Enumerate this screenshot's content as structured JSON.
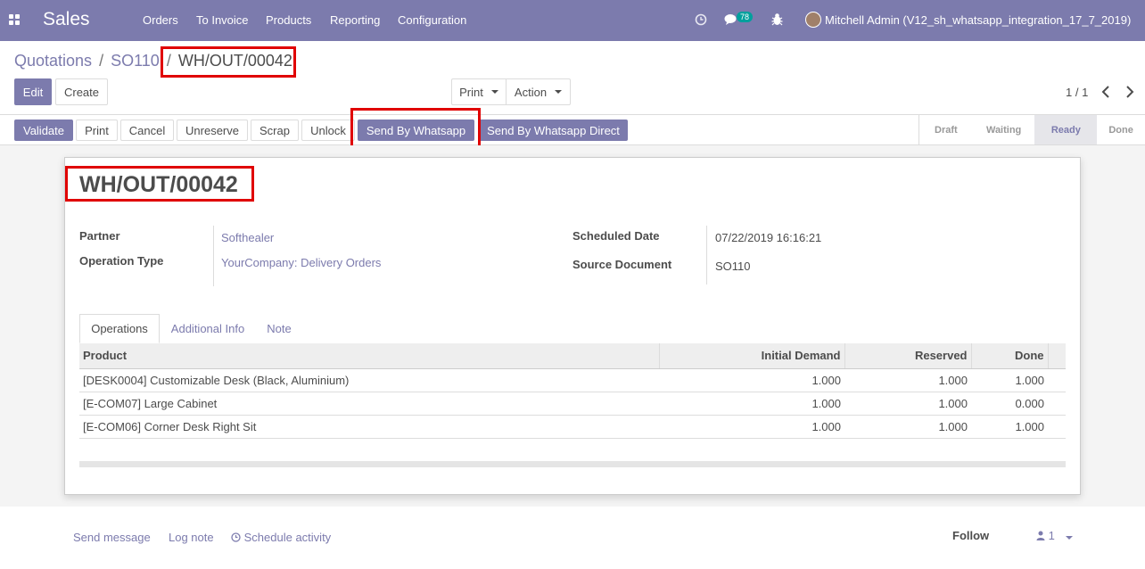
{
  "navbar": {
    "app_name": "Sales",
    "menu": [
      "Orders",
      "To Invoice",
      "Products",
      "Reporting",
      "Configuration"
    ],
    "messages_count": "78",
    "user": "Mitchell Admin (V12_sh_whatsapp_integration_17_7_2019)",
    "clock_icon": "clock-icon",
    "chat_icon": "chat-icon",
    "bug_icon": "bug-icon"
  },
  "breadcrumb": {
    "items": [
      "Quotations",
      "SO110"
    ],
    "separator": "/",
    "current": "WH/OUT/00042"
  },
  "control": {
    "edit": "Edit",
    "create": "Create",
    "print": "Print",
    "action": "Action",
    "pager": "1 / 1"
  },
  "header_buttons": {
    "validate": "Validate",
    "print": "Print",
    "cancel": "Cancel",
    "unreserve": "Unreserve",
    "scrap": "Scrap",
    "unlock": "Unlock",
    "send_whatsapp": "Send By Whatsapp",
    "send_whatsapp_direct": "Send By Whatsapp Direct"
  },
  "stages": [
    "Draft",
    "Waiting",
    "Ready",
    "Done"
  ],
  "current_stage": "Ready",
  "record": {
    "name": "WH/OUT/00042",
    "partner_label": "Partner",
    "partner": "Softhealer",
    "operation_type_label": "Operation Type",
    "operation_type": "YourCompany: Delivery Orders",
    "scheduled_date_label": "Scheduled Date",
    "scheduled_date": "07/22/2019 16:16:21",
    "source_document_label": "Source Document",
    "source_document": "SO110"
  },
  "tabs": [
    "Operations",
    "Additional Info",
    "Note"
  ],
  "table": {
    "headers": [
      "Product",
      "Initial Demand",
      "Reserved",
      "Done"
    ],
    "rows": [
      [
        "[DESK0004] Customizable Desk (Black, Aluminium)",
        "1.000",
        "1.000",
        "1.000"
      ],
      [
        "[E-COM07] Large Cabinet",
        "1.000",
        "1.000",
        "0.000"
      ],
      [
        "[E-COM06] Corner Desk Right Sit",
        "1.000",
        "1.000",
        "1.000"
      ]
    ]
  },
  "chatter": {
    "send_message": "Send message",
    "log_note": "Log note",
    "schedule_activity": "Schedule activity",
    "follow": "Follow",
    "followers": "1"
  },
  "colors": {
    "brand": "#7c7bad",
    "highlight": "#e00000"
  }
}
